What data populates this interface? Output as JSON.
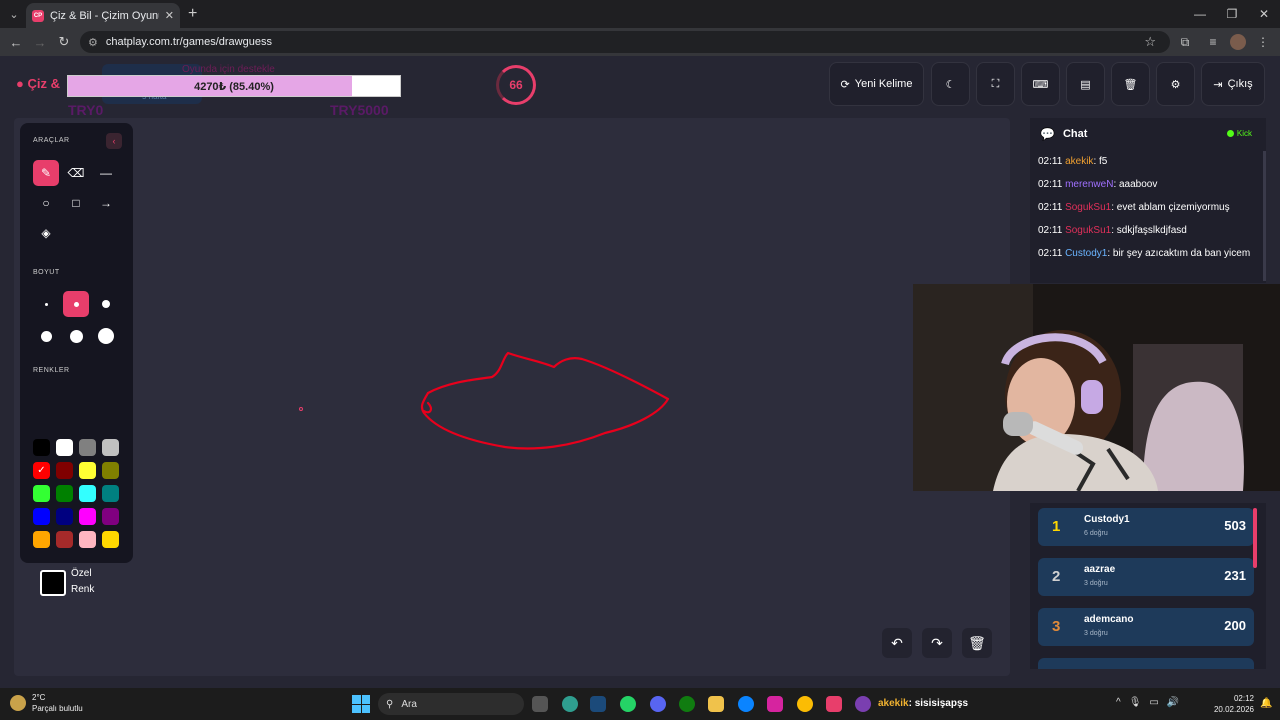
{
  "browser": {
    "tab_title": "Çiz & Bil - Çizim Oyunu",
    "favicon_text": "CP",
    "url": "chatplay.com.tr/games/drawguess"
  },
  "header": {
    "brand": "Çiz &",
    "goal_text": "4270₺ (85.40%)",
    "goal_progress": 0.854,
    "ghost_line1": "Oyunda için destekle",
    "ghost_line2": "5 hafta",
    "ghost_left": "TRY0",
    "ghost_right": "TRY5000",
    "timer": "66",
    "new_word_label": "Yeni Kelime",
    "exit_label": "Çıkış"
  },
  "tools": {
    "tools_label": "ARAÇLAR",
    "size_label": "BOYUT",
    "colors_label": "RENKLER",
    "custom_label_1": "Özel",
    "custom_label_2": "Renk",
    "colors": [
      "#000000",
      "#ffffff",
      "#808080",
      "#c0c0c0",
      "#ff0000",
      "#800000",
      "#ffff33",
      "#808000",
      "#33ff33",
      "#008000",
      "#33ffff",
      "#008080",
      "#0000ff",
      "#000080",
      "#ff00ff",
      "#800080",
      "#ffa500",
      "#a52a2a",
      "#ffb6c1",
      "#ffd700"
    ],
    "selected_color": "#ff0000"
  },
  "chat": {
    "title": "Chat",
    "platform": "Kick",
    "messages": [
      {
        "time": "02:11",
        "user": "akekik",
        "color": "#f0a030",
        "text": ": f5"
      },
      {
        "time": "02:11",
        "user": "merenweN",
        "color": "#a070ff",
        "text": ": aaaboov"
      },
      {
        "time": "02:11",
        "user": "SogukSu1",
        "color": "#e0305a",
        "text": ": evet ablam çizemiyormuş"
      },
      {
        "time": "02:11",
        "user": "SogukSu1",
        "color": "#e0305a",
        "text": ": sdkjfaşslkdjfasd"
      },
      {
        "time": "02:11",
        "user": "Custody1",
        "color": "#6ab4ff",
        "text": ": bir şey azıcaktım da ban yicem"
      }
    ]
  },
  "leaderboard": [
    {
      "rank": "1",
      "name": "Custody1",
      "sub": "6 doğru",
      "score": "503",
      "color": "#ffd700"
    },
    {
      "rank": "2",
      "name": "aazrae",
      "sub": "3 doğru",
      "score": "231",
      "color": "#d0d0d0"
    },
    {
      "rank": "3",
      "name": "ademcano",
      "sub": "3 doğru",
      "score": "200",
      "color": "#e08a3a"
    }
  ],
  "taskbar": {
    "temp": "2°C",
    "weather": "Parçalı bulutlu",
    "search": "Ara",
    "stream_user": "akekik",
    "stream_text": ": sisisişapşs",
    "time": "02:12",
    "date": "20.02.2026"
  }
}
